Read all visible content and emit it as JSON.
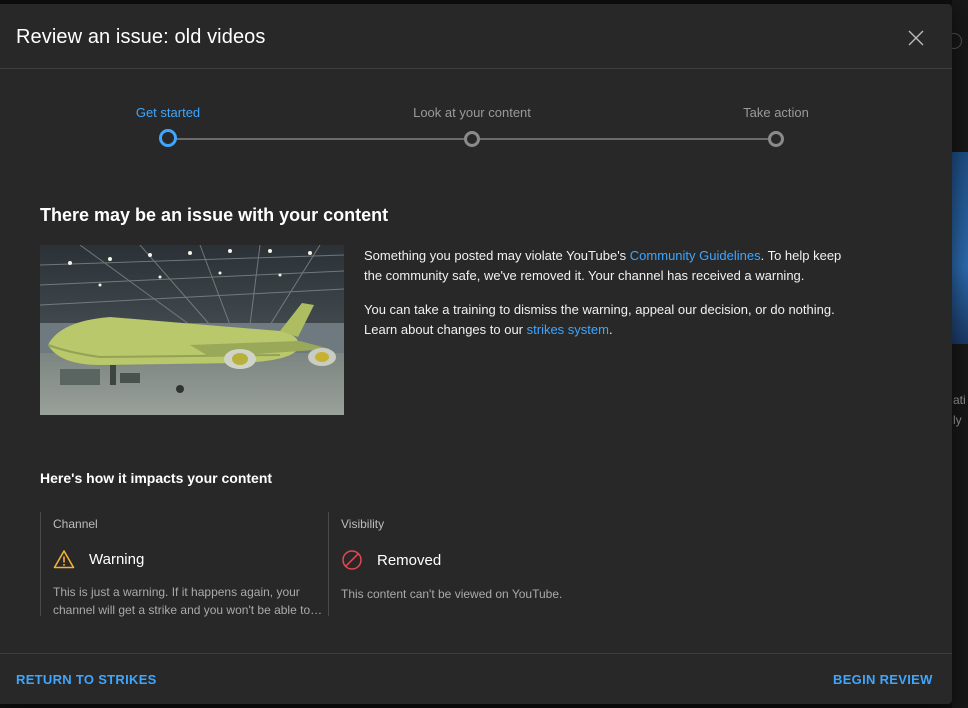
{
  "dialog": {
    "title": "Review an issue: old videos"
  },
  "stepper": {
    "steps": [
      {
        "label": "Get started",
        "active": true
      },
      {
        "label": "Look at your content",
        "active": false
      },
      {
        "label": "Take action",
        "active": false
      }
    ]
  },
  "main": {
    "heading": "There may be an issue with your content",
    "paragraph1_pre": "Something you posted may violate YouTube's ",
    "paragraph1_link": "Community Guidelines",
    "paragraph1_post": ". To help keep the community safe, we've removed it. Your channel has received a warning.",
    "paragraph2_pre": "You can take a training to dismiss the warning, appeal our decision, or do nothing. Learn about changes to our ",
    "paragraph2_link": "strikes system",
    "paragraph2_post": "."
  },
  "impact": {
    "heading": "Here's how it impacts your content",
    "channel": {
      "title": "Channel",
      "status": "Warning",
      "icon": "warning-icon",
      "description": "This is just a warning. If it happens again, your channel will get a strike and you won't be able to upload videos for a week."
    },
    "visibility": {
      "title": "Visibility",
      "status": "Removed",
      "icon": "removed-icon",
      "description": "This content can't be viewed on YouTube."
    }
  },
  "footer": {
    "left_button": "RETURN TO STRIKES",
    "right_button": "BEGIN REVIEW"
  },
  "background": {
    "text1": "ati",
    "text2": "ly"
  },
  "colors": {
    "accent": "#3ea6ff",
    "dialog_bg": "#282828",
    "warning": "#f2b134",
    "removed": "#e5484d"
  }
}
